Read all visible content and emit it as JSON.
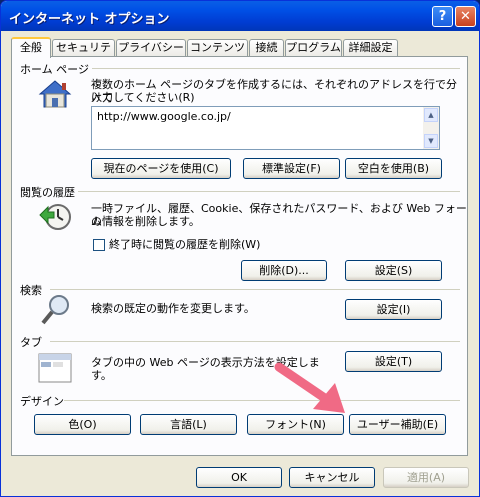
{
  "window": {
    "title": "インターネット オプション",
    "help": "?",
    "close": "✕"
  },
  "tabs": [
    "全般",
    "セキュリティ",
    "プライバシー",
    "コンテンツ",
    "接続",
    "プログラム",
    "詳細設定"
  ],
  "home": {
    "header": "ホーム ページ",
    "desc_line1": "複数のホーム ページのタブを作成するには、それぞれのアドレスを行で分けて",
    "desc_line2": "入力してください(R)",
    "url": "http://www.google.co.jp/",
    "btn_current": "現在のページを使用(C)",
    "btn_default": "標準設定(F)",
    "btn_blank": "空白を使用(B)"
  },
  "history": {
    "header": "閲覧の履歴",
    "desc_line1": "一時ファイル、履歴、Cookie、保存されたパスワード、および Web フォーム",
    "desc_line2": "の情報を削除します。",
    "checkbox_label": "終了時に閲覧の履歴を削除(W)",
    "btn_delete": "削除(D)...",
    "btn_settings": "設定(S)"
  },
  "search": {
    "header": "検索",
    "desc": "検索の既定の動作を変更します。",
    "btn_settings": "設定(I)"
  },
  "tabsection": {
    "header": "タブ",
    "desc_line1": "タブの中の Web ページの表示方法を設定しま",
    "desc_line2": "す。",
    "btn_settings": "設定(T)"
  },
  "design": {
    "header": "デザイン",
    "btn_color": "色(O)",
    "btn_language": "言語(L)",
    "btn_font": "フォント(N)",
    "btn_accessibility": "ユーザー補助(E)"
  },
  "footer": {
    "ok": "OK",
    "cancel": "キャンセル",
    "apply": "適用(A)"
  },
  "colors": {
    "titlebar": "#0050e6",
    "arrow": "#f06a85",
    "tab_highlight": "#ffc83c"
  }
}
